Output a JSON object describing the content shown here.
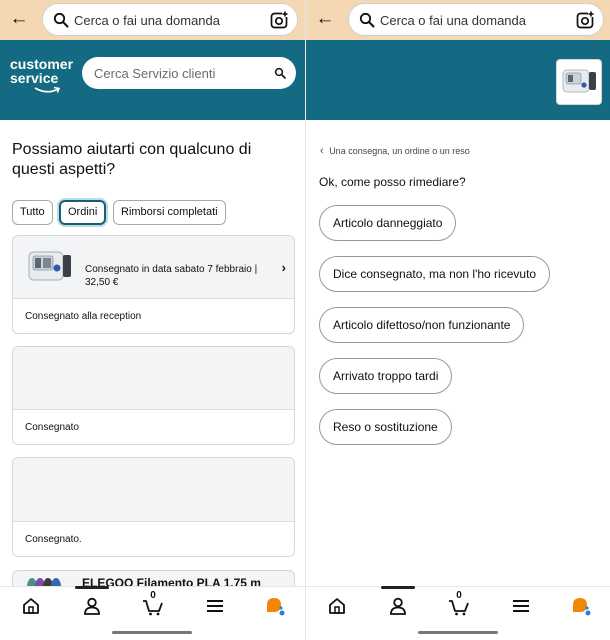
{
  "search": {
    "placeholder": "Cerca o fai una domanda"
  },
  "header": {
    "logo_line1": "customer",
    "logo_line2": "service",
    "cs_search_placeholder": "Cerca Servizio clienti"
  },
  "left": {
    "title": "Possiamo aiutarti con qualcuno di questi aspetti?",
    "filters": [
      {
        "label": "Tutto",
        "selected": false
      },
      {
        "label": "Ordini",
        "selected": true
      },
      {
        "label": "Rimborsi completati",
        "selected": false
      }
    ],
    "orders": [
      {
        "info": "Consegnato in data sabato 7 febbraio | 32,50 €",
        "status": "Consegnato alla reception"
      },
      {
        "info": "",
        "status": "Consegnato"
      },
      {
        "info": "",
        "status": "Consegnato."
      }
    ],
    "peek_text": "ELEGOO Filamento PLA 1,75 m"
  },
  "right": {
    "breadcrumb": "Una consegna, un ordine o un reso",
    "question": "Ok, come posso rimediare?",
    "options": [
      "Articolo danneggiato",
      "Dice consegnato, ma non l'ho ricevuto",
      "Articolo difettoso/non funzionante",
      "Arrivato troppo tardi",
      "Reso o sostituzione"
    ]
  },
  "nav": {
    "items": [
      "home-icon",
      "account-icon",
      "cart-icon",
      "menu-icon",
      "rufus-assistant-icon"
    ],
    "cart_count": "0"
  },
  "colors": {
    "top_bar": "#f3d8b3",
    "teal_header": "#146a82",
    "selected_chip": "#1a5f70"
  }
}
